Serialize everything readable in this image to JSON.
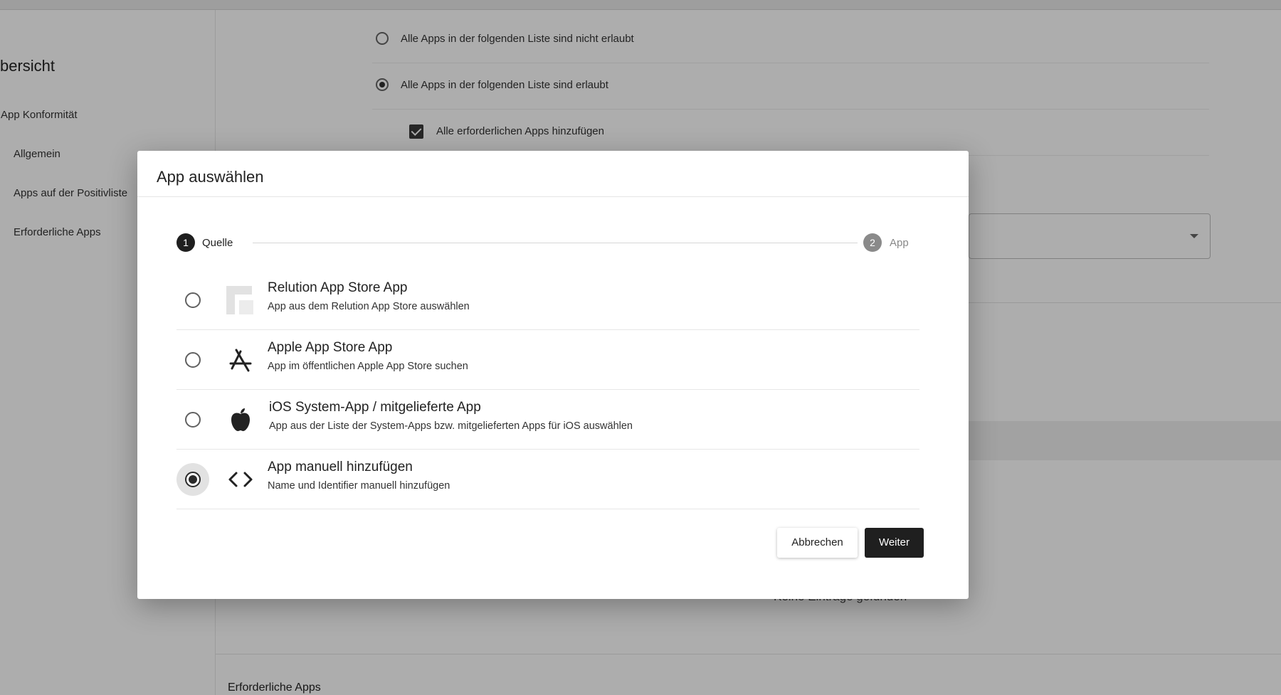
{
  "sidebar": {
    "title": "bersicht",
    "items": [
      {
        "label": "App Konformität"
      },
      {
        "label": "Allgemein"
      },
      {
        "label": "Apps auf der Positivliste"
      },
      {
        "label": "Erforderliche Apps"
      }
    ]
  },
  "background": {
    "options": [
      {
        "label": "Alle Apps in der folgenden Liste sind nicht erlaubt",
        "selected": false
      },
      {
        "label": "Alle Apps in der folgenden Liste sind erlaubt",
        "selected": true
      }
    ],
    "checkbox": {
      "label": "Alle erforderlichen Apps hinzufügen",
      "checked": true
    },
    "empty_text": "Keine Einträge gefunden",
    "section_title": "Erforderliche Apps"
  },
  "modal": {
    "title": "App auswählen",
    "steps": [
      {
        "number": "1",
        "label": "Quelle",
        "active": true
      },
      {
        "number": "2",
        "label": "App",
        "active": false
      }
    ],
    "sources": [
      {
        "icon": "relution-store-icon",
        "title": "Relution App Store App",
        "subtitle": "App aus dem Relution App Store auswählen",
        "selected": false
      },
      {
        "icon": "app-store-icon",
        "title": "Apple App Store App",
        "subtitle": "App im öffentlichen Apple App Store suchen",
        "selected": false
      },
      {
        "icon": "apple-logo-icon",
        "title": "iOS System-App / mitgelieferte App",
        "subtitle": "App aus der Liste der System-Apps bzw. mitgelieferten Apps für iOS auswählen",
        "selected": false
      },
      {
        "icon": "code-brackets-icon",
        "title": "App manuell hinzufügen",
        "subtitle": "Name und Identifier manuell hinzufügen",
        "selected": true
      }
    ],
    "cancel_label": "Abbrechen",
    "next_label": "Weiter"
  },
  "colors": {
    "overlay": "rgba(0,0,0,0.32)",
    "primary_button": "#1f1f1f",
    "step_active": "#1f1f1f",
    "step_inactive": "#8a8a8a"
  }
}
